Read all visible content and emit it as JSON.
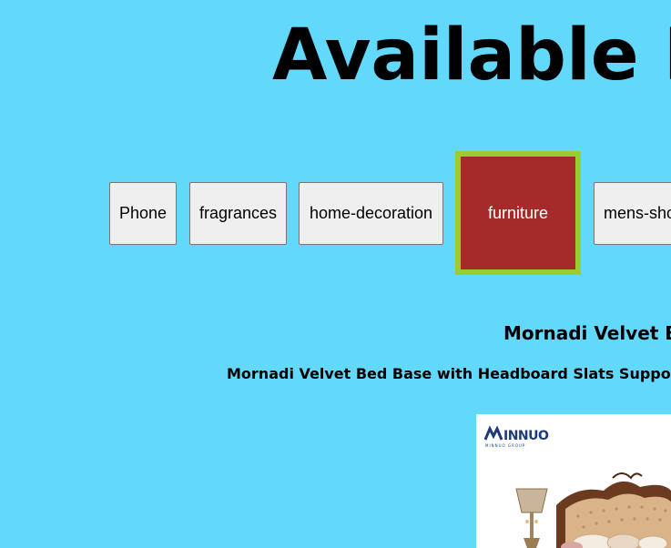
{
  "page": {
    "title": "Available P"
  },
  "categories": [
    {
      "label": "Phone",
      "active": false
    },
    {
      "label": "fragrances",
      "active": false
    },
    {
      "label": "home-decoration",
      "active": false
    },
    {
      "label": "furniture",
      "active": true
    },
    {
      "label": "mens-sho",
      "active": false
    }
  ],
  "product": {
    "name": "Mornadi Velvet B",
    "description": "Mornadi Velvet Bed Base with Headboard Slats Support C",
    "image": {
      "brand_logo_text": "MINNUO",
      "brand_tagline": "MINNUO GROUP"
    }
  },
  "colors": {
    "background": "#62d9fb",
    "button_bg": "#efefef",
    "active_bg": "#a52a2a",
    "active_border": "#9acd32"
  }
}
